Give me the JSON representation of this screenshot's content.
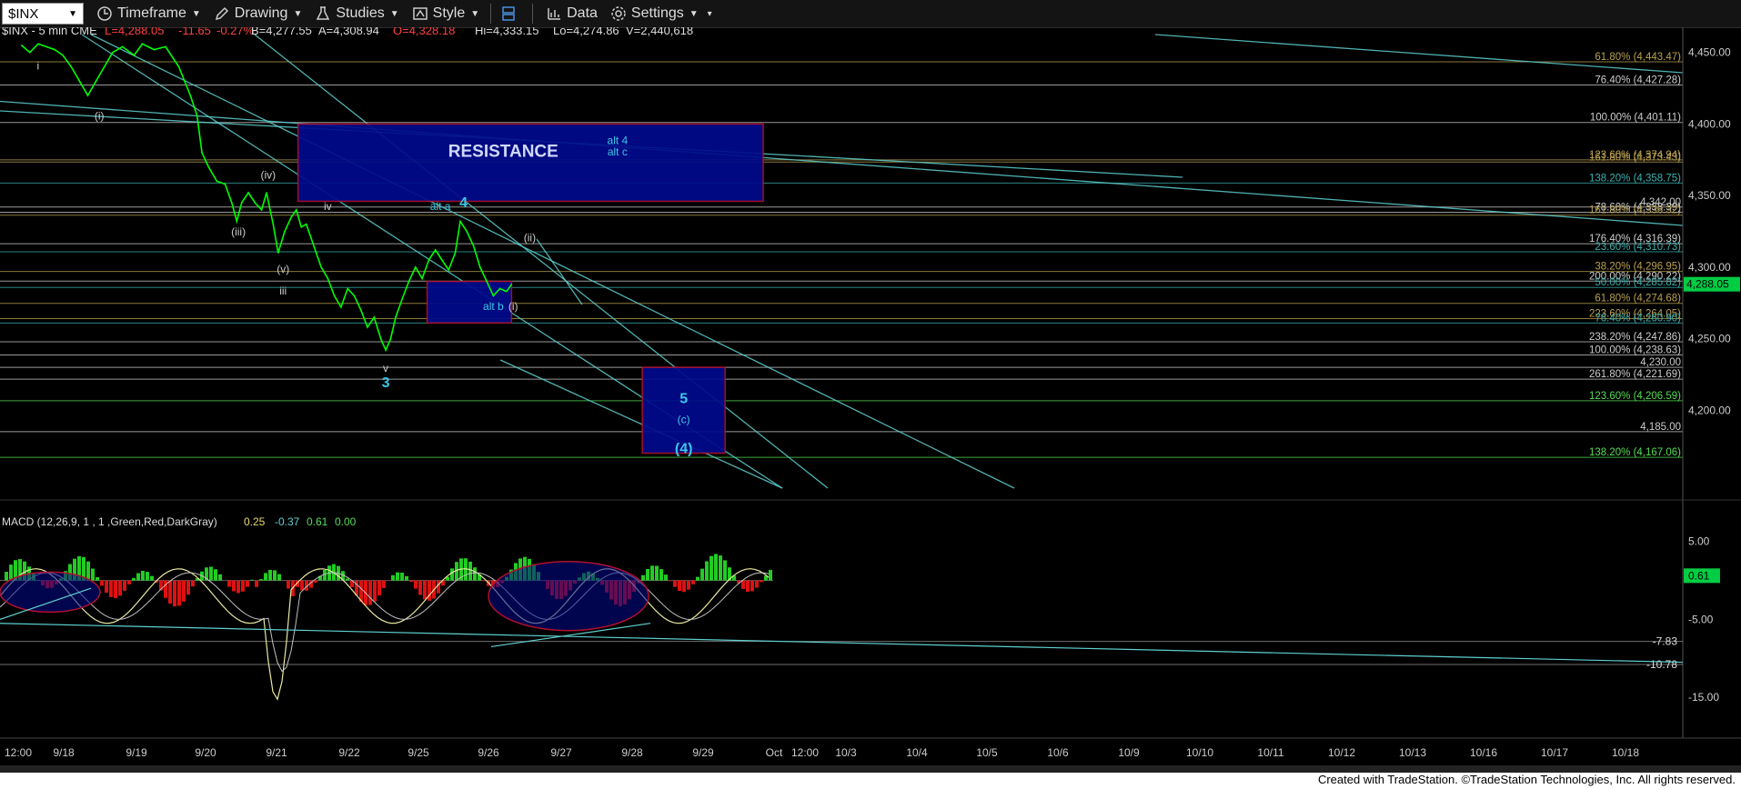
{
  "toolbar": {
    "symbol": "$INX",
    "timeframe": "Timeframe",
    "drawing": "Drawing",
    "studies": "Studies",
    "style": "Style",
    "data": "Data",
    "settings": "Settings"
  },
  "header": {
    "symbol_line": "$INX - 5 min  CME",
    "last": "L=4,288.05",
    "chg": "-11.65",
    "pct": "-0.27%",
    "bid": "B=4,277.55",
    "ask": "A=4,308.94",
    "open": "O=4,328.18",
    "hi": "Hi=4,333.15",
    "lo": "Lo=4,274.86",
    "vol": "V=2,440,618"
  },
  "colors": {
    "price": "#00ff00",
    "trend_line": "#5fd0d0",
    "box_fill": "#000a8c",
    "box_border": "#b01030",
    "axis_text": "#cccccc",
    "last_price_bg": "#00cc44"
  },
  "chart_data": {
    "type": "line",
    "title": "$INX - 5 min",
    "price_axis": {
      "ylim": [
        4150,
        4460
      ],
      "ticks": [
        "4,450.00",
        "4,400.00",
        "4,350.00",
        "4,300.00",
        "4,250.00",
        "4,200.00"
      ],
      "tick_values": [
        4450,
        4400,
        4350,
        4300,
        4250,
        4200
      ],
      "last_price_label": "4,288.05",
      "last_price": 4288.05
    },
    "x_axis": {
      "labels": [
        "12:00",
        "9/18",
        "9/19",
        "9/20",
        "9/21",
        "9/22",
        "9/25",
        "9/26",
        "9/27",
        "9/28",
        "9/29",
        "Oct",
        "12:00",
        "10/3",
        "10/4",
        "10/5",
        "10/6",
        "10/9",
        "10/10",
        "10/11",
        "10/12",
        "10/13",
        "10/16",
        "10/17",
        "10/18"
      ]
    },
    "series": [
      {
        "values": [
          [
            9.5,
            4455
          ],
          [
            10,
            4450
          ],
          [
            10.5,
            4456
          ],
          [
            11.5,
            4452
          ],
          [
            12,
            4448
          ],
          [
            12.5,
            4440
          ],
          [
            13,
            4430
          ],
          [
            13.5,
            4420
          ],
          [
            14,
            4430
          ],
          [
            14.5,
            4440
          ],
          [
            15,
            4450
          ],
          [
            15.6,
            4454
          ],
          [
            16.3,
            4448
          ],
          [
            16.8,
            4456
          ],
          [
            17.5,
            4452
          ],
          [
            18.2,
            4454
          ],
          [
            19,
            4440
          ],
          [
            19.7,
            4420
          ],
          [
            20.1,
            4406
          ],
          [
            20.4,
            4380
          ],
          [
            20.8,
            4370
          ],
          [
            21.3,
            4360
          ],
          [
            21.8,
            4358
          ],
          [
            22.2,
            4345
          ],
          [
            22.5,
            4332
          ],
          [
            22.8,
            4345
          ],
          [
            23.2,
            4352
          ],
          [
            23.6,
            4345
          ],
          [
            24,
            4340
          ],
          [
            24.3,
            4352
          ],
          [
            24.7,
            4330
          ],
          [
            25,
            4310
          ],
          [
            25.4,
            4325
          ],
          [
            25.8,
            4335
          ],
          [
            26.1,
            4340
          ],
          [
            26.4,
            4328
          ],
          [
            26.7,
            4330
          ],
          [
            27,
            4320
          ],
          [
            27.3,
            4310
          ],
          [
            27.6,
            4300
          ],
          [
            28,
            4292
          ],
          [
            28.4,
            4280
          ],
          [
            28.8,
            4272
          ],
          [
            29.2,
            4285
          ],
          [
            29.6,
            4280
          ],
          [
            30,
            4270
          ],
          [
            30.4,
            4258
          ],
          [
            30.8,
            4265
          ],
          [
            31.2,
            4250
          ],
          [
            31.5,
            4242
          ],
          [
            31.8,
            4250
          ],
          [
            32.1,
            4265
          ],
          [
            32.5,
            4278
          ],
          [
            32.9,
            4290
          ],
          [
            33.3,
            4300
          ],
          [
            33.7,
            4292
          ],
          [
            34.1,
            4305
          ],
          [
            34.5,
            4312
          ],
          [
            34.9,
            4305
          ],
          [
            35.3,
            4298
          ],
          [
            35.7,
            4310
          ],
          [
            36,
            4332
          ],
          [
            36.4,
            4325
          ],
          [
            36.8,
            4315
          ],
          [
            37.2,
            4300
          ],
          [
            37.6,
            4290
          ],
          [
            38,
            4280
          ],
          [
            38.4,
            4285
          ],
          [
            38.8,
            4283
          ],
          [
            39.1,
            4288
          ]
        ]
      }
    ],
    "fib_labels": [
      {
        "text": "61.80% (4,443.47)",
        "value": 4443.47,
        "color": "#b8a050"
      },
      {
        "text": "76.40% (4,427.28)",
        "value": 4427.28,
        "color": "#ccc"
      },
      {
        "text": "100.00% (4,401.11)",
        "value": 4401.11,
        "color": "#ccc"
      },
      {
        "text": "123.60% (4,374.94)",
        "value": 4374.94,
        "color": "#b8a050"
      },
      {
        "text": "161.80% (4,373.43)",
        "value": 4373.43,
        "color": "#b8a050"
      },
      {
        "text": "138.20% (4,358.75)",
        "value": 4358.75,
        "color": "#3cb0b0"
      },
      {
        "text": "4,342.00",
        "value": 4342.0,
        "color": "#ccc"
      },
      {
        "text": "78.60% (4,338.39)",
        "value": 4338.39,
        "color": "#ccc"
      },
      {
        "text": "161.80% (4,336.32)",
        "value": 4336.32,
        "color": "#b8a050"
      },
      {
        "text": "176.40% (4,316.39)",
        "value": 4316.39,
        "color": "#ccc"
      },
      {
        "text": "23.60% (4,310.73)",
        "value": 4310.73,
        "color": "#3cb0b0"
      },
      {
        "text": "38.20% (4,296.95)",
        "value": 4296.95,
        "color": "#b8a050"
      },
      {
        "text": "200.00% (4,290.22)",
        "value": 4290.22,
        "color": "#ccc"
      },
      {
        "text": "50.00% (4,285.82)",
        "value": 4285.82,
        "color": "#3cb0b0"
      },
      {
        "text": "61.80% (4,274.68)",
        "value": 4274.68,
        "color": "#b8a050"
      },
      {
        "text": "223.60% (4,264.05)",
        "value": 4264.05,
        "color": "#b8a050"
      },
      {
        "text": "76.40% (4,260.90)",
        "value": 4260.9,
        "color": "#3cb0b0"
      },
      {
        "text": "238.20% (4,247.86)",
        "value": 4247.86,
        "color": "#ccc"
      },
      {
        "text": "100.00% (4,238.63)",
        "value": 4238.63,
        "color": "#ccc"
      },
      {
        "text": "4,230.00",
        "value": 4230.0,
        "color": "#ccc"
      },
      {
        "text": "261.80% (4,221.69)",
        "value": 4221.69,
        "color": "#ccc"
      },
      {
        "text": "123.60% (4,206.59)",
        "value": 4206.59,
        "color": "#55dd55"
      },
      {
        "text": "4,185.00",
        "value": 4185.0,
        "color": "#ccc"
      },
      {
        "text": "138.20% (4,167.06)",
        "value": 4167.06,
        "color": "#55dd55"
      }
    ],
    "annotations": [
      {
        "text": "i",
        "x": 10.5,
        "y": 4438,
        "color": "#ccc"
      },
      {
        "text": "(i)",
        "x": 14.2,
        "y": 4403,
        "color": "#ccc"
      },
      {
        "text": "(iv)",
        "x": 24.4,
        "y": 4362,
        "color": "#ccc"
      },
      {
        "text": "(iii)",
        "x": 22.6,
        "y": 4322,
        "color": "#ccc"
      },
      {
        "text": "(v)",
        "x": 25.3,
        "y": 4296,
        "color": "#ccc"
      },
      {
        "text": "iii",
        "x": 25.3,
        "y": 4281,
        "color": "#ccc"
      },
      {
        "text": "iv",
        "x": 28.0,
        "y": 4340,
        "color": "#ccc"
      },
      {
        "text": "v",
        "x": 31.5,
        "y": 4227,
        "color": "#ccc"
      },
      {
        "text": "3",
        "x": 31.5,
        "y": 4216,
        "color": "#3cc8e8"
      },
      {
        "text": "alt a",
        "x": 34.8,
        "y": 4340,
        "color": "#3cc8e8"
      },
      {
        "text": "4",
        "x": 36.2,
        "y": 4342,
        "color": "#3cc8e8"
      },
      {
        "text": "(ii)",
        "x": 40.2,
        "y": 4318,
        "color": "#ccc"
      },
      {
        "text": "alt b",
        "x": 38.0,
        "y": 4270,
        "color": "#3cc8e8"
      },
      {
        "text": "(i)",
        "x": 39.2,
        "y": 4270,
        "color": "#ccc"
      },
      {
        "text": "alt 4",
        "x": 45.5,
        "y": 4386,
        "color": "#3cc8e8"
      },
      {
        "text": "alt c",
        "x": 45.5,
        "y": 4378,
        "color": "#3cc8e8"
      },
      {
        "text": "5",
        "x": 49.5,
        "y": 4205,
        "color": "#3cc8e8"
      },
      {
        "text": "(c)",
        "x": 49.5,
        "y": 4191,
        "color": "#3cc8e8"
      },
      {
        "text": "(4)",
        "x": 49.5,
        "y": 4170,
        "color": "#3cc8e8"
      }
    ],
    "boxes": [
      {
        "label": "RESISTANCE",
        "x0": 26.2,
        "x1": 54.3,
        "y0": 4346,
        "y1": 4400
      },
      {
        "label": "",
        "x0": 34.0,
        "x1": 39.1,
        "y0": 4261,
        "y1": 4290
      },
      {
        "label": "",
        "x0": 47.0,
        "x1": 52.0,
        "y0": 4170,
        "y1": 4230
      }
    ],
    "macd": {
      "label": "MACD (12,26,9, 1 , 1 ,Green,Red,DarkGray)",
      "values": [
        "0.25",
        "-0.37",
        "0.61",
        "0.00"
      ],
      "ylim": [
        -20,
        8
      ],
      "ticks": [
        "5.00",
        "-5.00",
        "-15.00"
      ],
      "tick_values": [
        5,
        -5,
        -15
      ],
      "current": "0.61",
      "current_value": 0.61,
      "level_labels": [
        "-7.83",
        "-10.78"
      ],
      "level_values": [
        -7.83,
        -10.78
      ]
    }
  },
  "footer": "Created with TradeStation. ©TradeStation Technologies, Inc. All rights reserved."
}
